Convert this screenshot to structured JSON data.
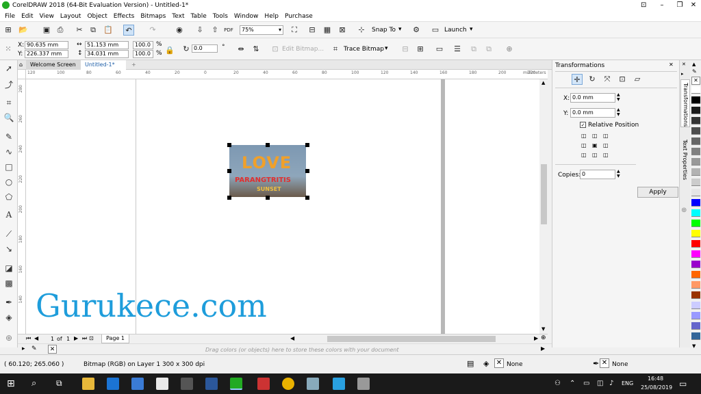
{
  "window": {
    "title": "CorelDRAW 2018 (64-Bit Evaluation Version) - Untitled-1*",
    "controls": [
      "–",
      "❐",
      "✕"
    ]
  },
  "menu": [
    "File",
    "Edit",
    "View",
    "Layout",
    "Object",
    "Effects",
    "Bitmaps",
    "Text",
    "Table",
    "Tools",
    "Window",
    "Help",
    "Purchase"
  ],
  "toolbar": {
    "zoom": "75%",
    "snap_label": "Snap To",
    "launch_label": "Launch"
  },
  "propbar": {
    "x": "90.635 mm",
    "y": "226.337 mm",
    "w": "51.153 mm",
    "h": "34.031 mm",
    "scale_w": "100.0",
    "scale_h": "100.0",
    "percent": "%",
    "angle": "0.0",
    "degree": "°",
    "edit_bitmap": "Edit Bitmap...",
    "trace_bitmap": "Trace Bitmap"
  },
  "tabs": {
    "welcome": "Welcome Screen",
    "doc": "Untitled-1*",
    "add": "+"
  },
  "ruler": {
    "h_ticks": [
      "120",
      "100",
      "80",
      "60",
      "40",
      "20",
      "0",
      "20",
      "40",
      "60",
      "80",
      "100",
      "120",
      "140",
      "160",
      "180",
      "200",
      "220",
      "240"
    ],
    "unit": "millimeters",
    "v_ticks": [
      "280",
      "260",
      "240",
      "220",
      "200",
      "180",
      "160",
      "140"
    ]
  },
  "image": {
    "line1": "LOVE",
    "line2": "PARANGTRITIS",
    "line3": "SUNSET"
  },
  "watermark": "Gurukece.com",
  "pagenav": {
    "current": "1",
    "of": "of",
    "total": "1",
    "page_tab": "Page 1"
  },
  "palette_hint": "Drag colors (or objects) here to store these colors with your document",
  "status": {
    "coords": "( 60.120; 265.060 )",
    "object": "Bitmap (RGB) on Layer 1 300 x 300 dpi",
    "fill": "None",
    "outline": "None"
  },
  "docker": {
    "title": "Transformations",
    "x_label": "X:",
    "x_value": "0.0 mm",
    "y_label": "Y:",
    "y_value": "0.0 mm",
    "relative": "Relative Position",
    "copies_label": "Copies:",
    "copies_value": "0",
    "apply": "Apply",
    "tab1": "Transformations",
    "tab2": "Text Properties"
  },
  "palette_colors": [
    "#ffffff",
    "#000000",
    "#1a1a1a",
    "#333333",
    "#4d4d4d",
    "#666666",
    "#808080",
    "#999999",
    "#b3b3b3",
    "#cccccc",
    "#e6e6e6",
    "#0000ff",
    "#00ffff",
    "#00ff00",
    "#ffff00",
    "#ff0000",
    "#ff00ff",
    "#9900cc",
    "#ff6600",
    "#ff9966",
    "#993300",
    "#ccccff",
    "#9999ff",
    "#6666cc",
    "#336699"
  ],
  "taskbar": {
    "lang": "ENG",
    "time": "16:48",
    "date": "25/08/2019"
  }
}
